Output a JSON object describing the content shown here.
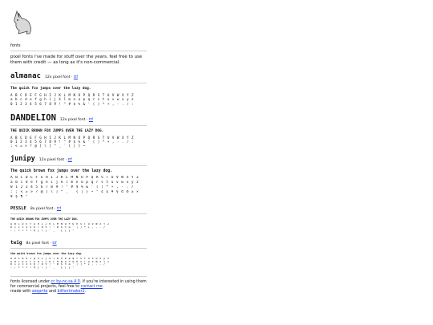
{
  "site": {
    "title": "fonts"
  },
  "intro": "pixel fonts i've made for stuff over the years. feel free to use them with credit — as long as it's non-commercial.",
  "fonts": [
    {
      "name": "almanac",
      "size": "12x pixel font",
      "link": "ttf",
      "sample": "The quick fox jumps over the lazy dog.",
      "glyphs": [
        "A B C D E F G H I J K L M N O P Q R S T U V W X Y Z",
        "a b c d e f g h i j k l m n o p q r s t u v w x y z",
        "0 1 2 3 4 5 6 7 8 9 ! \" # $ % & ' ( ) * + , - . / :"
      ]
    },
    {
      "name": "DANDELION",
      "size": "12x pixel font",
      "link": "ttf",
      "sample": "THE QUICK BROWN FOX JUMPS OVER THE LAZY DOG.",
      "glyphs": [
        "A B C D E F G H I J K L M N O P Q R S T U V W X Y Z",
        "0 1 2 3 4 5 6 7 8 9 ! \" # $ % & ' ( ) * + , - . / :",
        "; < = > ? @ [ \\ ] ^ _ ` { | } ~"
      ]
    },
    {
      "name": "junipy",
      "size": "12x pixel font",
      "link": "ttf",
      "sample": "The quick brown fox jumps over the lazy dog.",
      "glyphs": [
        "A B C D E F G H I J K L M N O P Q R S T U V W X Y Z",
        "a b c d e f g h i j k l m n o p q r s t u v w x y z",
        "0 1 2 3 4 5 6 7 8 9 ! \" # $ % & ' ( ) * + , - . /",
        ": ; < = > ? @ [ \\ ] ^ _ ` { | } ~ ° ¢ £ ¥ § © ® ± ×",
        "¥ § ¶ °"
      ]
    },
    {
      "name": "PESSLE",
      "size": "8x pixel font",
      "link": "ttf",
      "sample": "THE QUICK BROWN FOX JUMPS OVER THE LAZY DOG.",
      "glyphs": [
        "A B C D E F G H I J K L M N O P Q R S T U V W X Y Z",
        "0 1 2 3 4 5 6 7 8 9 ! \" # $ % & ' ( ) * + , - . /",
        ": ; < = > ? @ [ \\ ] ^ _ ` { | } ~"
      ]
    },
    {
      "name": "twig",
      "size": "8x pixel font",
      "link": "ttf",
      "sample": "the quick brown fox jumps over the lazy dog.",
      "glyphs": [
        "a b c d e f g h i j k l m n o p q r s t u v w x y z",
        "A B C D E F G H I J K L M N O P Q R S T U V W X Y Z",
        "0 1 2 3 4 5 6 7 8 9 ! \" # $ % & ' ( ) * + , - . /",
        ": ; < = > ? @ [ \\ ] ^ _ ` { | } ~"
      ]
    }
  ],
  "footer": {
    "license_prefix": "fonts licensed under",
    "license_link": "cc by-nc-sa 4.0",
    "license_mid": ". if you're interested in using them for commercial projects, feel free to",
    "contact_link": "contact me",
    "license_end": ".",
    "made_with": "made with",
    "tool1": "aseprite",
    "and": "and",
    "tool2": "bitfontmaker2",
    "end": "."
  }
}
